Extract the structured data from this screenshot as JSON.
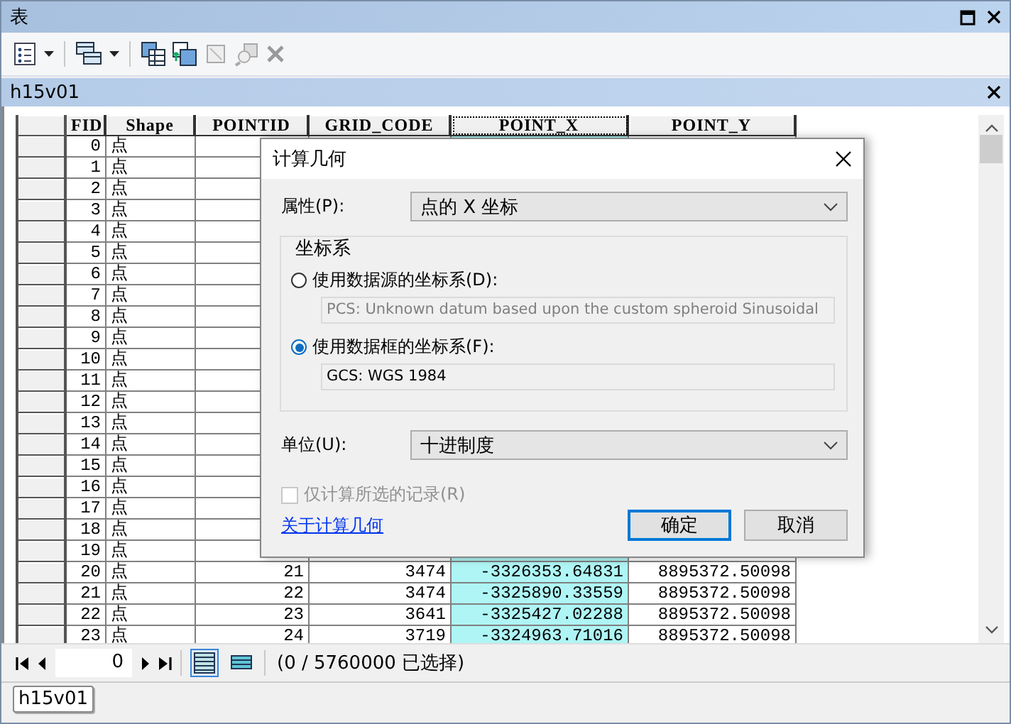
{
  "window": {
    "title": "表"
  },
  "table_tab": {
    "title": "h15v01"
  },
  "table": {
    "columns": [
      {
        "label": "FID",
        "selected": false
      },
      {
        "label": "Shape",
        "selected": false
      },
      {
        "label": "POINTID",
        "selected": false
      },
      {
        "label": "GRID_CODE",
        "selected": false
      },
      {
        "label": "POINT_X",
        "selected": true
      },
      {
        "label": "POINT_Y",
        "selected": false
      }
    ],
    "rows": [
      {
        "cells": [
          "0",
          "点"
        ]
      },
      {
        "cells": [
          "1",
          "点"
        ]
      },
      {
        "cells": [
          "2",
          "点"
        ]
      },
      {
        "cells": [
          "3",
          "点"
        ]
      },
      {
        "cells": [
          "4",
          "点"
        ]
      },
      {
        "cells": [
          "5",
          "点"
        ]
      },
      {
        "cells": [
          "6",
          "点"
        ]
      },
      {
        "cells": [
          "7",
          "点"
        ]
      },
      {
        "cells": [
          "8",
          "点"
        ]
      },
      {
        "cells": [
          "9",
          "点"
        ]
      },
      {
        "cells": [
          "10",
          "点"
        ]
      },
      {
        "cells": [
          "11",
          "点"
        ]
      },
      {
        "cells": [
          "12",
          "点"
        ]
      },
      {
        "cells": [
          "13",
          "点"
        ]
      },
      {
        "cells": [
          "14",
          "点"
        ]
      },
      {
        "cells": [
          "15",
          "点"
        ]
      },
      {
        "cells": [
          "16",
          "点"
        ]
      },
      {
        "cells": [
          "17",
          "点"
        ]
      },
      {
        "cells": [
          "18",
          "点"
        ]
      },
      {
        "cells": [
          "19",
          "点"
        ]
      },
      {
        "cells": [
          "20",
          "点",
          "21",
          "3474",
          "-3326353.64831",
          "8895372.50098"
        ]
      },
      {
        "cells": [
          "21",
          "点",
          "22",
          "3474",
          "-3325890.33559",
          "8895372.50098"
        ]
      },
      {
        "cells": [
          "22",
          "点",
          "23",
          "3641",
          "-3325427.02288",
          "8895372.50098"
        ]
      },
      {
        "cells": [
          "23",
          "点",
          "24",
          "3719",
          "-3324963.71016",
          "8895372.50098"
        ]
      }
    ]
  },
  "navigation": {
    "record": "0",
    "views": [
      {
        "selected": true
      },
      {
        "selected": false
      }
    ],
    "status": "(0 / 5760000 已选择)"
  },
  "bottom_tabs": [
    {
      "label": "h15v01",
      "selected": true
    }
  ],
  "dialog": {
    "title": "计算几何",
    "property": {
      "label": "属性(P):",
      "value": "点的 X 坐标"
    },
    "coordinate_system": {
      "legend": "坐标系",
      "options": [
        {
          "label": "使用数据源的坐标系(D):",
          "value": "PCS: Unknown datum based upon the custom spheroid Sinusoidal",
          "selected": false
        },
        {
          "label": "使用数据框的坐标系(F):",
          "value": "GCS: WGS 1984",
          "selected": true
        }
      ]
    },
    "units": {
      "label": "单位(U):",
      "value": "十进制度"
    },
    "selected_only": {
      "label": "仅计算所选的记录(R)",
      "checked": false,
      "disabled": true
    },
    "help_link": "关于计算几何",
    "buttons": [
      {
        "label": "确定",
        "kind": "default"
      },
      {
        "label": "取消",
        "kind": "normal"
      }
    ]
  }
}
